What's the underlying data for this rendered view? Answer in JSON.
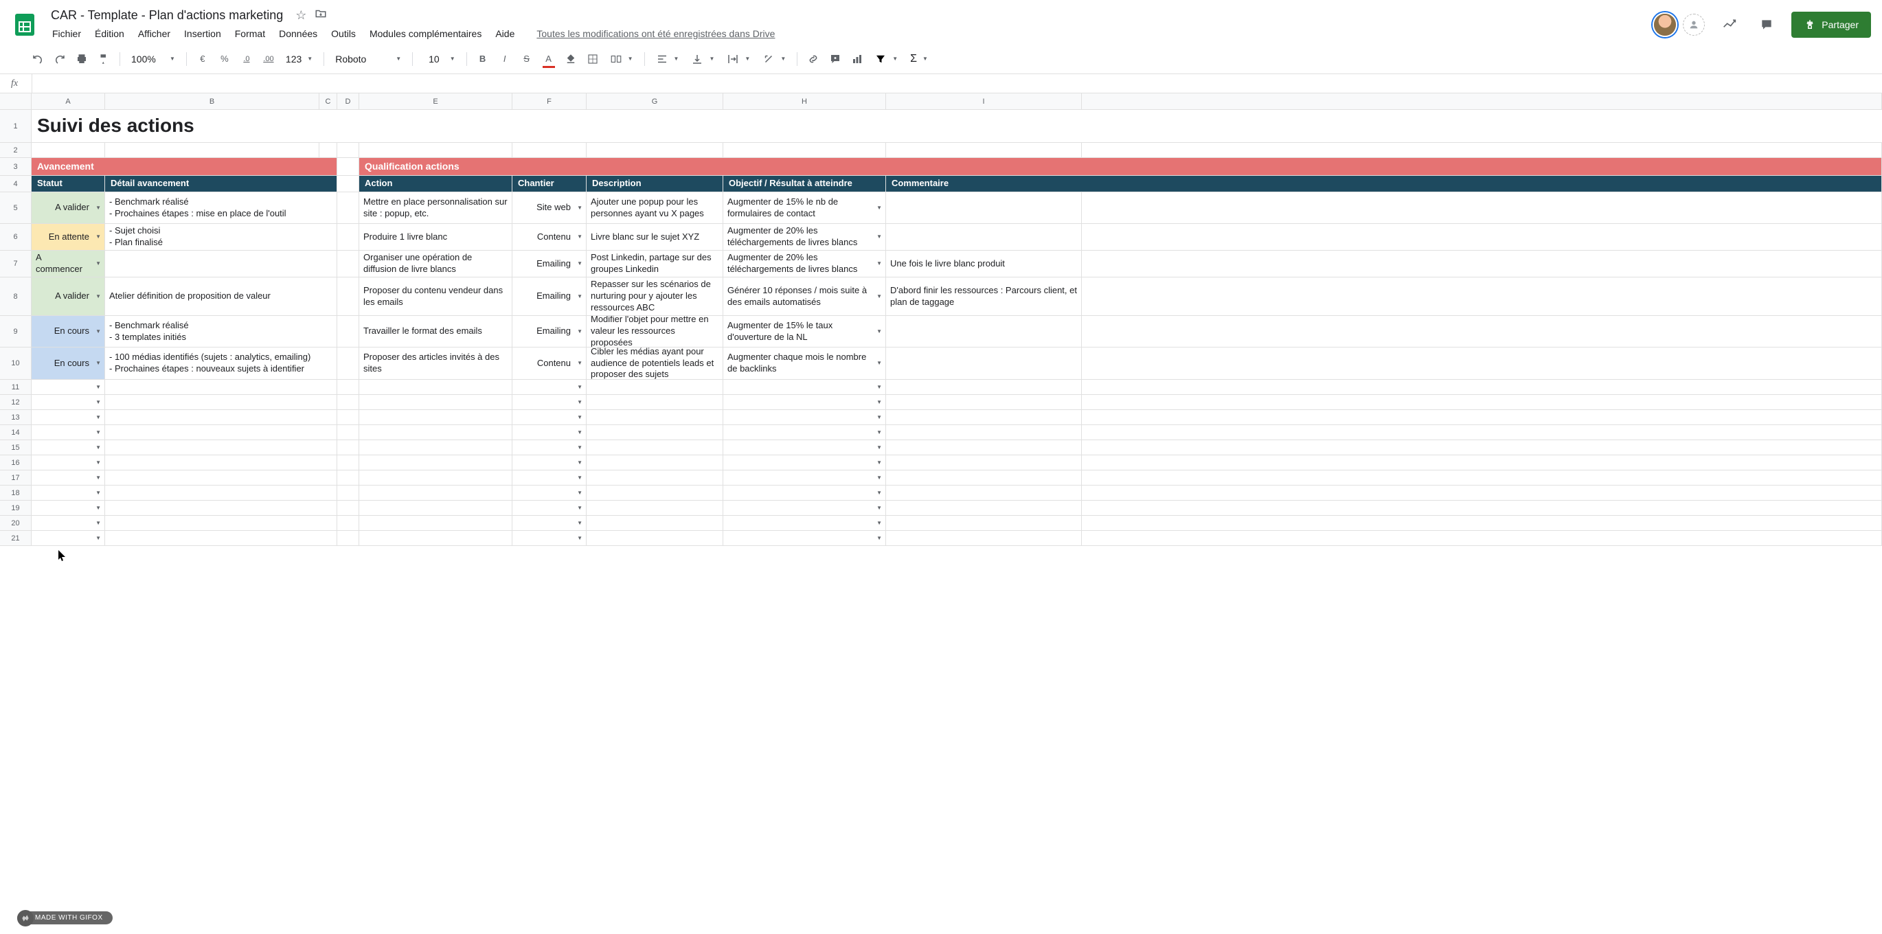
{
  "doc_title": "CAR - Template - Plan d'actions marketing",
  "menu": {
    "fichier": "Fichier",
    "edition": "Édition",
    "afficher": "Afficher",
    "insertion": "Insertion",
    "format": "Format",
    "donnees": "Données",
    "outils": "Outils",
    "modules": "Modules complémentaires",
    "aide": "Aide",
    "save_status": "Toutes les modifications ont été enregistrées dans Drive"
  },
  "toolbar": {
    "zoom": "100%",
    "currency": "€",
    "percent": "%",
    "dec_minus": ".0",
    "dec_plus": ".00",
    "num_fmt": "123",
    "font": "Roboto",
    "font_size": "10"
  },
  "share_label": "Partager",
  "sheet": {
    "title": "Suivi des actions",
    "section_avancement": "Avancement",
    "section_qualification": "Qualification actions",
    "headers": {
      "statut": "Statut",
      "detail": "Détail avancement",
      "action": "Action",
      "chantier": "Chantier",
      "description": "Description",
      "objectif": "Objectif / Résultat à atteindre",
      "commentaire": "Commentaire"
    },
    "columns": [
      "A",
      "B",
      "C",
      "D",
      "E",
      "F",
      "G",
      "H",
      "I"
    ],
    "row_nums": [
      "1",
      "2",
      "3",
      "4",
      "5",
      "6",
      "7",
      "8",
      "9",
      "10",
      "11",
      "12",
      "13",
      "14",
      "15",
      "16",
      "17",
      "18",
      "19",
      "20",
      "21"
    ],
    "rows": [
      {
        "statut": "A valider",
        "statut_class": "status-avalider",
        "detail": "- Benchmark réalisé\n- Prochaines étapes : mise en place de l'outil",
        "action": "Mettre en place personnalisation sur site : popup, etc.",
        "chantier": "Site web",
        "description": "Ajouter une popup pour les personnes ayant vu X pages",
        "objectif": "Augmenter de 15% le nb de formulaires de contact",
        "commentaire": ""
      },
      {
        "statut": "En attente",
        "statut_class": "status-enattente",
        "detail": "- Sujet choisi\n- Plan finalisé",
        "action": "Produire 1 livre blanc",
        "chantier": "Contenu",
        "description": "Livre blanc sur le sujet XYZ",
        "objectif": "Augmenter de 20% les téléchargements de livres blancs",
        "commentaire": ""
      },
      {
        "statut": "A commencer",
        "statut_class": "status-acommencer",
        "detail": "",
        "action": "Organiser une opération de diffusion de livre blancs",
        "chantier": "Emailing",
        "description": "Post Linkedin, partage sur des groupes Linkedin",
        "objectif": "Augmenter de 20% les téléchargements de livres blancs",
        "commentaire": "Une fois le livre blanc produit"
      },
      {
        "statut": "A valider",
        "statut_class": "status-avalider",
        "detail": "Atelier définition de proposition de valeur",
        "action": "Proposer du contenu vendeur dans les emails",
        "chantier": "Emailing",
        "description": "Repasser sur les scénarios de nurturing pour y ajouter les ressources ABC",
        "objectif": "Générer 10 réponses / mois suite à des emails automatisés",
        "commentaire": "D'abord finir les ressources : Parcours client, et plan de taggage"
      },
      {
        "statut": "En cours",
        "statut_class": "status-encours",
        "detail": "- Benchmark réalisé\n- 3 templates initiés",
        "action": "Travailler le format des emails",
        "chantier": "Emailing",
        "description": "Modifier l'objet pour mettre en valeur les ressources proposées",
        "objectif": "Augmenter de 15% le taux d'ouverture de la NL",
        "commentaire": ""
      },
      {
        "statut": "En cours",
        "statut_class": "status-encours",
        "detail": "- 100 médias identifiés (sujets : analytics, emailing)\n- Prochaines étapes : nouveaux sujets à identifier",
        "action": "Proposer des articles invités à des sites",
        "chantier": "Contenu",
        "description": "Cibler les médias ayant pour audience de potentiels leads et proposer des sujets",
        "objectif": "Augmenter chaque mois le nombre de backlinks",
        "commentaire": ""
      }
    ]
  },
  "gifox": "MADE WITH GIFOX"
}
